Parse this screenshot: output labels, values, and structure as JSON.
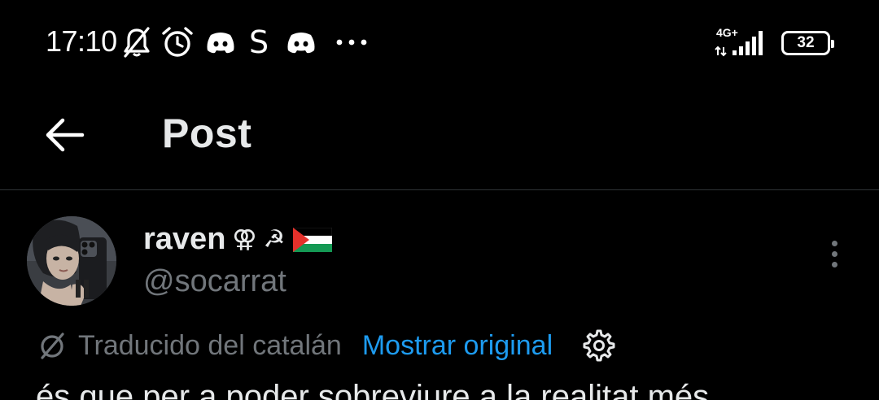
{
  "status_bar": {
    "time": "17:10",
    "network": "4G+",
    "battery_level": "32",
    "battery_percent": 32,
    "icons": [
      "bell-muted-icon",
      "alarm-clock-icon",
      "discord-icon",
      "s-app-icon",
      "discord-icon",
      "more-dots-icon"
    ],
    "s_glyph": "S"
  },
  "header": {
    "title": "Post",
    "back_icon": "back-arrow-icon"
  },
  "post": {
    "author": {
      "display_name": "raven",
      "name_emojis": [
        "⚢",
        "☭",
        "palestine-flag"
      ],
      "handle": "@socarrat"
    },
    "translation": {
      "label": "Traducido del catalán",
      "show_original": "Mostrar original"
    },
    "text_partial": "és que per a poder sobreviure a la realitat més"
  },
  "colors": {
    "background": "#000000",
    "text_primary": "#e7e9ea",
    "text_secondary": "#71767b",
    "accent": "#1d9bf0",
    "divider": "#2f3336"
  }
}
